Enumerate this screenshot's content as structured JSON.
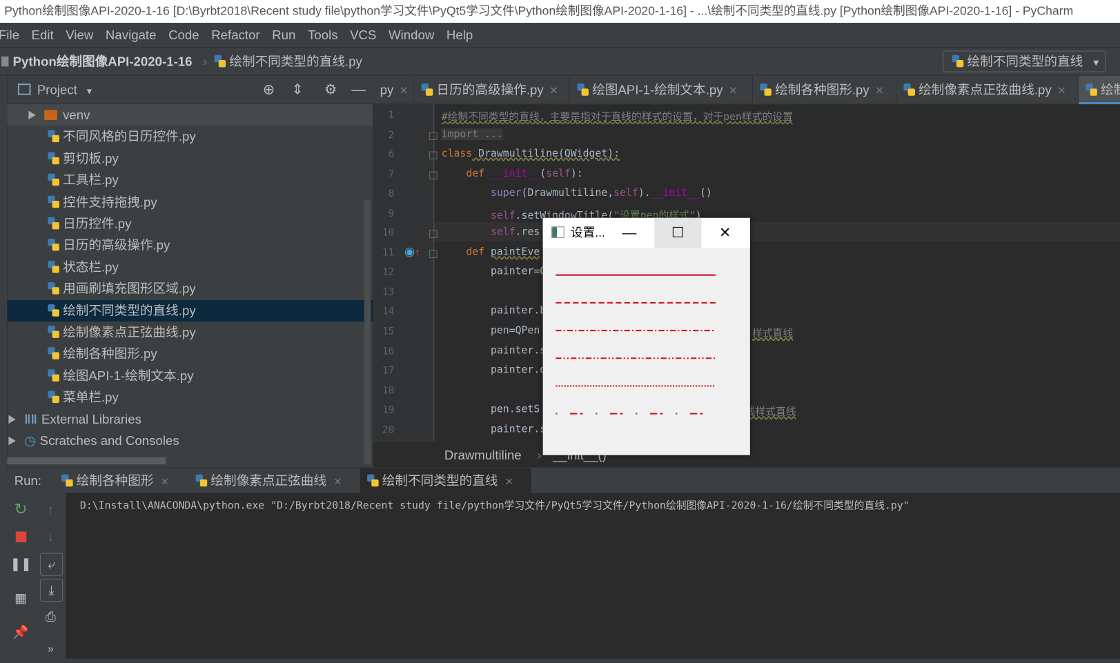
{
  "window": {
    "title": "Python绘制图像API-2020-1-16 [D:\\Byrbt2018\\Recent study file\\python学习文件\\PyQt5学习文件\\Python绘制图像API-2020-1-16] - ...\\绘制不同类型的直线.py [Python绘制图像API-2020-1-16] - PyCharm"
  },
  "menu": [
    "File",
    "Edit",
    "View",
    "Navigate",
    "Code",
    "Refactor",
    "Run",
    "Tools",
    "VCS",
    "Window",
    "Help"
  ],
  "nav": {
    "project": "Python绘制图像API-2020-1-16",
    "file": "绘制不同类型的直线.py",
    "run_config": "绘制不同类型的直线"
  },
  "project_panel": {
    "title": "Project",
    "items": [
      {
        "label": "venv",
        "type": "folder"
      },
      {
        "label": "不同风格的日历控件.py",
        "type": "py"
      },
      {
        "label": "剪切板.py",
        "type": "py"
      },
      {
        "label": "工具栏.py",
        "type": "py"
      },
      {
        "label": "控件支持拖拽.py",
        "type": "py"
      },
      {
        "label": "日历控件.py",
        "type": "py"
      },
      {
        "label": "日历的高级操作.py",
        "type": "py"
      },
      {
        "label": "状态栏.py",
        "type": "py"
      },
      {
        "label": "用画刷填充图形区域.py",
        "type": "py"
      },
      {
        "label": "绘制不同类型的直线.py",
        "type": "py",
        "selected": true
      },
      {
        "label": "绘制像素点正弦曲线.py",
        "type": "py"
      },
      {
        "label": "绘制各种图形.py",
        "type": "py"
      },
      {
        "label": "绘图API-1-绘制文本.py",
        "type": "py"
      },
      {
        "label": "菜单栏.py",
        "type": "py"
      },
      {
        "label": "External Libraries",
        "type": "lib"
      },
      {
        "label": "Scratches and Consoles",
        "type": "scratch"
      }
    ]
  },
  "editor_tabs": [
    "py",
    "日历的高级操作.py",
    "绘图API-1-绘制文本.py",
    "绘制各种图形.py",
    "绘制像素点正弦曲线.py",
    "绘制"
  ],
  "code": [
    {
      "n": "1",
      "segs": [
        [
          "#绘制不同类型的直线，主要是指对于直线的样式的设置，对于pen样式的设置",
          "cmt"
        ]
      ]
    },
    {
      "n": "2",
      "segs": [
        [
          "import ...",
          "fold"
        ]
      ]
    },
    {
      "n": "6",
      "segs": [
        [
          "class",
          "kw"
        ],
        [
          " Drawmultiline(QWidget):",
          "wavy"
        ]
      ]
    },
    {
      "n": "7",
      "segs": [
        [
          "    ",
          ""
        ],
        [
          "def ",
          "kw"
        ],
        [
          "__init__",
          "fn"
        ],
        [
          "(",
          ""
        ],
        [
          "self",
          "self"
        ],
        [
          "):",
          ""
        ]
      ]
    },
    {
      "n": "8",
      "segs": [
        [
          "        ",
          ""
        ],
        [
          "super",
          "bi"
        ],
        [
          "(Drawmultiline,",
          ""
        ],
        [
          "self",
          "self"
        ],
        [
          ").",
          ""
        ],
        [
          "__init__",
          "fn"
        ],
        [
          "()",
          ""
        ]
      ]
    },
    {
      "n": "9",
      "segs": [
        [
          "        ",
          ""
        ],
        [
          "self",
          "self"
        ],
        [
          ".setWindowTitle(",
          ""
        ],
        [
          "\"设置pen的样式\"",
          "str"
        ],
        [
          ")",
          ""
        ]
      ]
    },
    {
      "n": "10",
      "segs": [
        [
          "        ",
          ""
        ],
        [
          "self",
          "self"
        ],
        [
          ".res",
          ""
        ]
      ]
    },
    {
      "n": "11",
      "segs": [
        [
          "    ",
          ""
        ],
        [
          "def ",
          "kw"
        ],
        [
          "paintEve",
          "wavy"
        ]
      ]
    },
    {
      "n": "12",
      "segs": [
        [
          "        painter=Q",
          ""
        ]
      ]
    },
    {
      "n": "13",
      "segs": []
    },
    {
      "n": "14",
      "segs": [
        [
          "        painter.b",
          ""
        ]
      ]
    },
    {
      "n": "15",
      "segs": [
        [
          "        pen=QPen",
          ""
        ]
      ],
      "tail": "样式直线"
    },
    {
      "n": "16",
      "segs": [
        [
          "        painter.s",
          ""
        ]
      ]
    },
    {
      "n": "17",
      "segs": [
        [
          "        painter.d",
          ""
        ]
      ]
    },
    {
      "n": "18",
      "segs": []
    },
    {
      "n": "19",
      "segs": [
        [
          "        pen.setS",
          ""
        ]
      ],
      "tail": "线样式直线"
    },
    {
      "n": "20",
      "segs": [
        [
          "        painter.s",
          ""
        ]
      ]
    }
  ],
  "breadcrumb": [
    "Drawmultiline",
    "__init__()"
  ],
  "run": {
    "label": "Run:",
    "tabs": [
      "绘制各种图形",
      "绘制像素点正弦曲线",
      "绘制不同类型的直线"
    ],
    "output": "D:\\Install\\ANACONDA\\python.exe \"D:/Byrbt2018/Recent study file/python学习文件/PyQt5学习文件/Python绘制图像API-2020-1-16/绘制不同类型的直线.py\""
  },
  "dialog": {
    "title": "设置...",
    "line_color": "#d0121b",
    "line_styles": [
      "SolidLine",
      "DashLine",
      "DashDotLine",
      "DashDotDotLine",
      "DotLine",
      "CustomDashLine"
    ]
  },
  "colors": {
    "ide_bg": "#2b2b2b",
    "panel_bg": "#3c3f41",
    "selection": "#0d293e",
    "accent": "#4a88c7"
  }
}
